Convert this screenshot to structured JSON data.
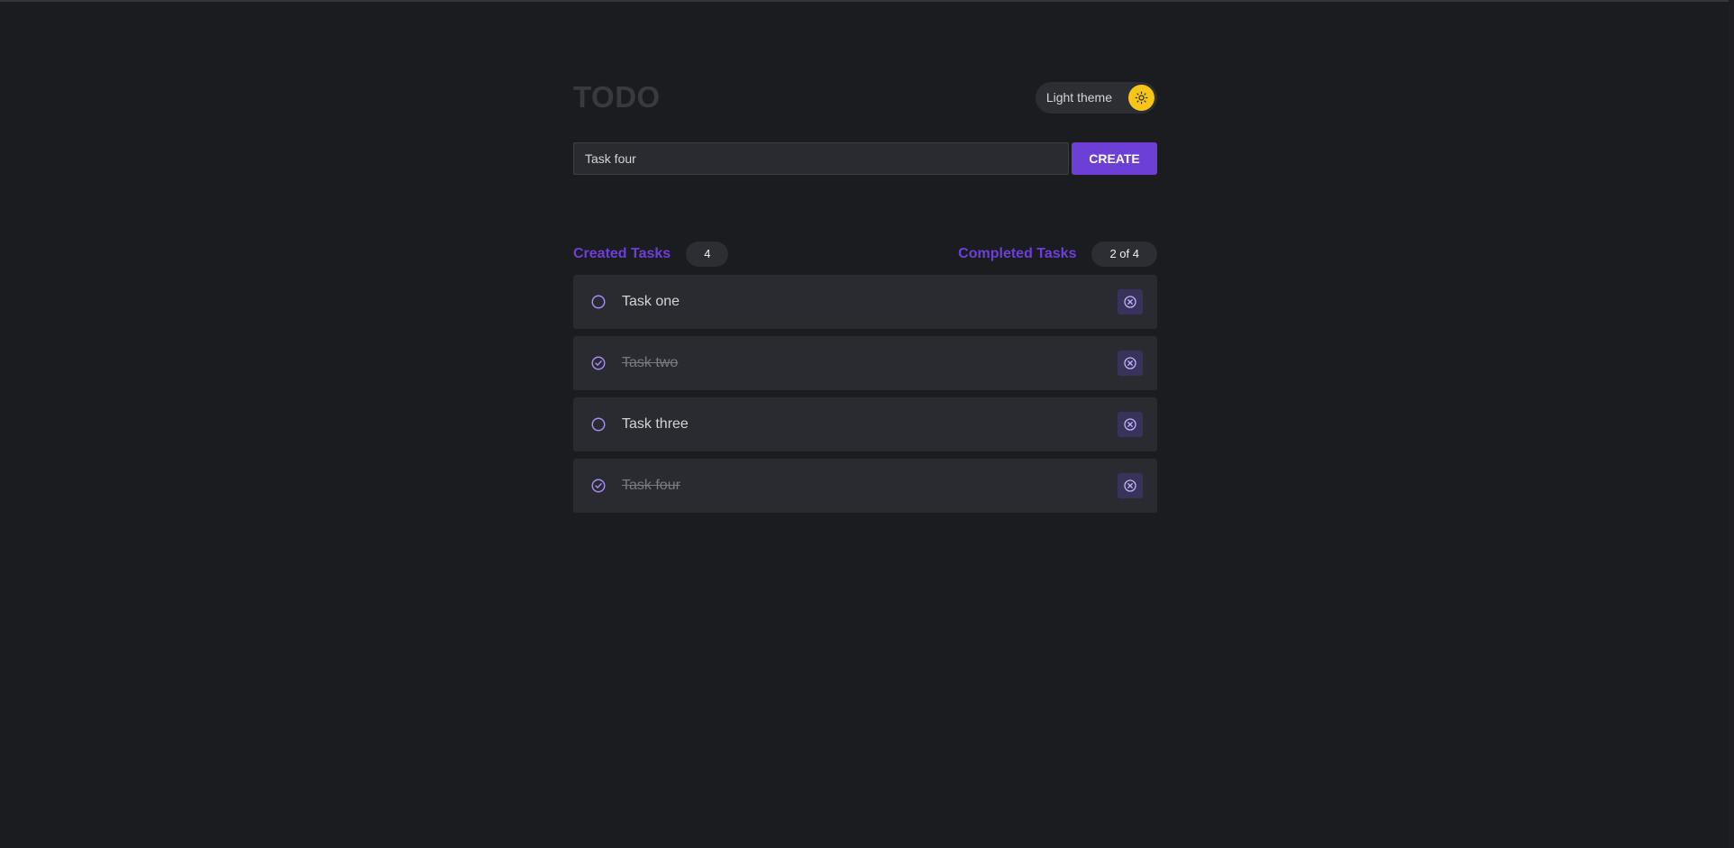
{
  "app": {
    "title": "TODO",
    "theme_toggle_label": "Light theme"
  },
  "create": {
    "input_value": "Task four",
    "button_label": "CREATE"
  },
  "stats": {
    "created_label": "Created Tasks",
    "created_count": "4",
    "completed_label": "Completed Tasks",
    "completed_count": "2 of 4"
  },
  "tasks": [
    {
      "text": "Task one",
      "done": false
    },
    {
      "text": "Task two",
      "done": true
    },
    {
      "text": "Task three",
      "done": false
    },
    {
      "text": "Task four",
      "done": true
    }
  ],
  "colors": {
    "accent": "#6c3fd6",
    "background": "#1b1c20",
    "sun": "#f5c518"
  },
  "icons": {
    "theme": "sun-icon",
    "unchecked": "circle-icon",
    "checked": "check-circle-icon",
    "delete": "x-circle-icon"
  }
}
